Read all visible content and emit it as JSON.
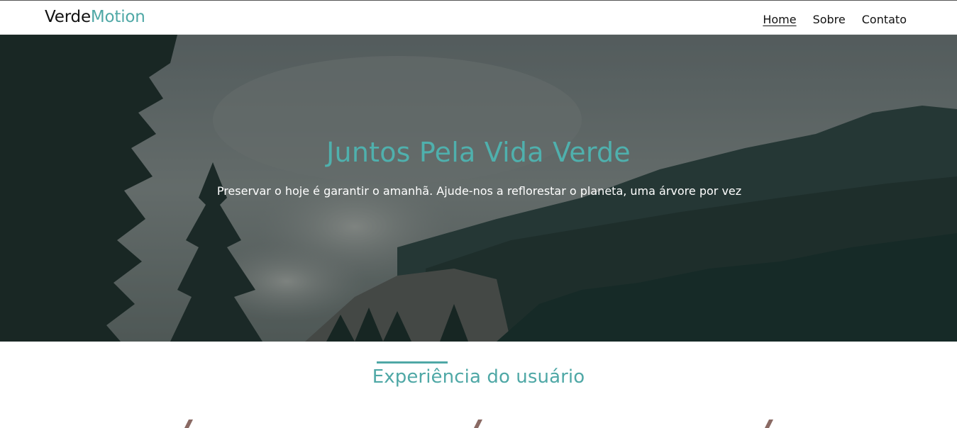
{
  "brand": {
    "name_main": "Verde",
    "name_accent": "Motion",
    "accent_color": "#4fa8a6"
  },
  "nav": {
    "items": [
      {
        "label": "Home",
        "active": true
      },
      {
        "label": "Sobre",
        "active": false
      },
      {
        "label": "Contato",
        "active": false
      }
    ]
  },
  "hero": {
    "title": "Juntos Pela Vida Verde",
    "subtitle": "Preservar o hoje é garantir o amanhã. Ajude-nos a reflorestar o planeta, uma árvore por vez",
    "title_color": "#4fb0ad",
    "image": "forest-mountain-smoke"
  },
  "section": {
    "title": "Experiência do usuário"
  }
}
